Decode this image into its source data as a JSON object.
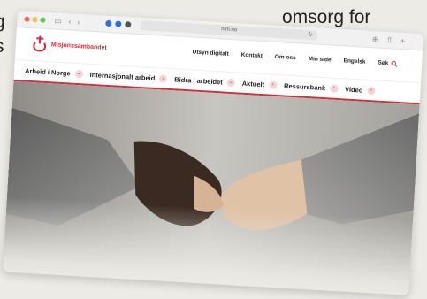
{
  "background_text": {
    "left_line_1": "g",
    "left_line_2": "s",
    "right": "omsorg for"
  },
  "browser": {
    "url": "nlm.no",
    "colors": {
      "traffic_red": "#ef6b5e",
      "traffic_yellow": "#f5c04f",
      "traffic_green": "#5ec45a"
    },
    "icons": [
      "sidebar-icon",
      "back-icon",
      "forward-icon",
      "extension-icon",
      "reload-icon",
      "download-icon",
      "share-icon",
      "new-tab-icon"
    ]
  },
  "site": {
    "logo_text": "Misjonssambandet",
    "brand_color": "#d1303a",
    "utility_nav": [
      "Utsyn digitalt",
      "Kontakt",
      "Om oss",
      "Min side",
      "Engelsk"
    ],
    "search_label": "Søk",
    "main_nav": [
      {
        "label": "Arbeid i Norge",
        "icon": "chevron-down-icon"
      },
      {
        "label": "Internasjonalt arbeid",
        "icon": "chevron-down-icon"
      },
      {
        "label": "Bidra i arbeidet",
        "icon": "chevron-down-icon"
      },
      {
        "label": "Aktuelt",
        "icon": "chevron-right-icon"
      },
      {
        "label": "Ressursbank",
        "icon": "chevron-right-icon"
      },
      {
        "label": "Video",
        "icon": "chevron-right-icon"
      }
    ]
  }
}
